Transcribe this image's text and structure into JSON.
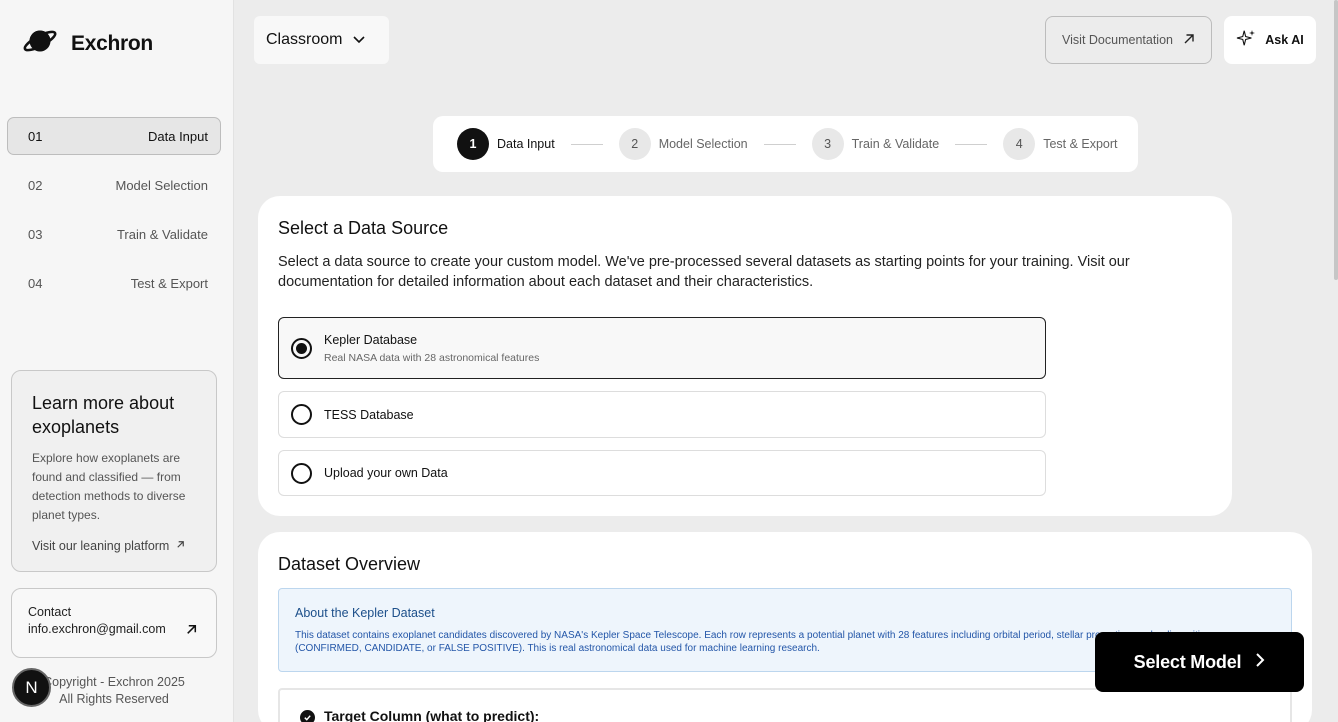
{
  "brand": {
    "name": "Exchron",
    "logo_icon": "planet-icon"
  },
  "sidebar": {
    "items": [
      {
        "num": "01",
        "label": "Data Input",
        "active": true
      },
      {
        "num": "02",
        "label": "Model Selection",
        "active": false
      },
      {
        "num": "03",
        "label": "Train & Validate",
        "active": false
      },
      {
        "num": "04",
        "label": "Test & Export",
        "active": false
      }
    ],
    "learn": {
      "title": "Learn more about exoplanets",
      "description": "Explore how exoplanets are found and classified — from detection methods to diverse planet types.",
      "link": "Visit our leaning platform"
    },
    "contact": {
      "label": "Contact",
      "email": "info.exchron@gmail.com"
    },
    "copyright": "Copyright - Exchron 2025 All Rights Reserved",
    "avatar_letter": "N"
  },
  "topbar": {
    "workspace": "Classroom",
    "docs_button": "Visit Documentation",
    "ai_button": "Ask AI"
  },
  "stepper": {
    "steps": [
      {
        "num": "1",
        "label": "Data Input",
        "active": true
      },
      {
        "num": "2",
        "label": "Model Selection",
        "active": false
      },
      {
        "num": "3",
        "label": "Train & Validate",
        "active": false
      },
      {
        "num": "4",
        "label": "Test & Export",
        "active": false
      }
    ]
  },
  "data_source": {
    "title": "Select a Data Source",
    "description": "Select a data source to create your custom model. We've pre-processed several datasets as starting points for your training. Visit our documentation for detailed information about each dataset and their characteristics.",
    "options": [
      {
        "label": "Kepler Database",
        "sublabel": "Real NASA data with 28 astronomical features",
        "selected": true
      },
      {
        "label": "TESS Database",
        "sublabel": "",
        "selected": false
      },
      {
        "label": "Upload your own Data",
        "sublabel": "",
        "selected": false
      }
    ]
  },
  "overview": {
    "title": "Dataset Overview",
    "about_title": "About the Kepler Dataset",
    "about_text": "This dataset contains exoplanet candidates discovered by NASA's Kepler Space Telescope. Each row represents a potential planet with 28 features including orbital period, stellar properties, and a disposition (CONFIRMED, CANDIDATE, or FALSE POSITIVE). This is real astronomical data used for machine learning research.",
    "target_label": "Target Column (what to predict):"
  },
  "cta": {
    "label": "Select Model"
  }
}
